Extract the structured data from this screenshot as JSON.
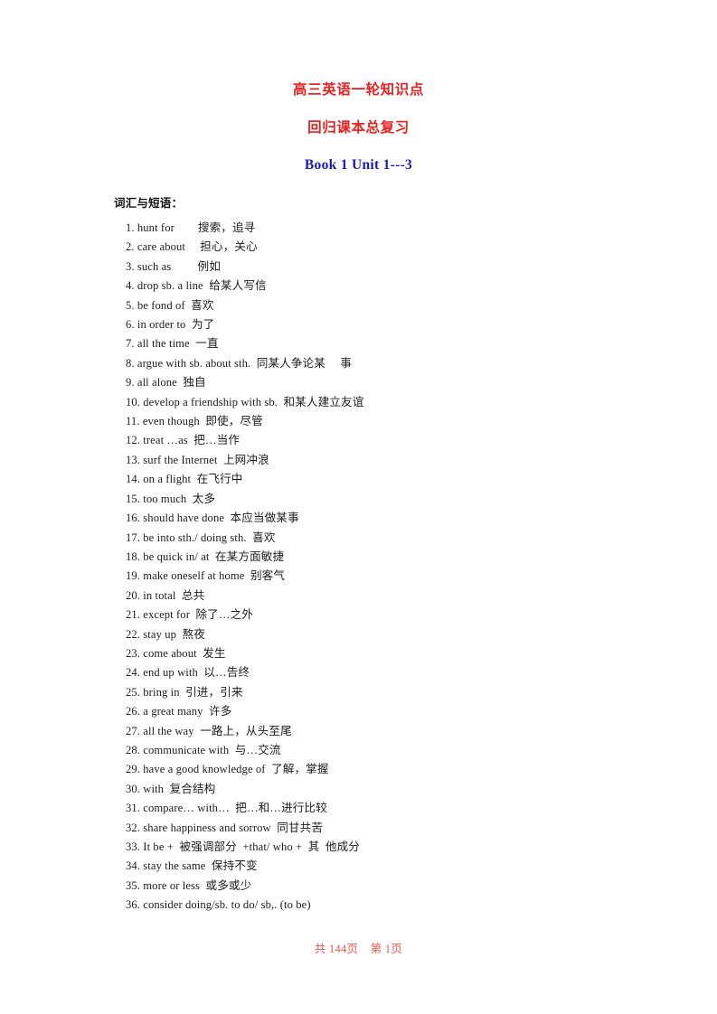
{
  "document": {
    "title": "高三英语一轮知识点",
    "subtitle": "回归课本总复习",
    "unit": "Book 1 Unit  1---3",
    "title_color": "#e8231f",
    "unit_color": "#1a1ab4",
    "footer_color": "#e8564e"
  },
  "section": {
    "heading": "词汇与短语："
  },
  "vocabulary": [
    "1. hunt for        搜索，追寻",
    "2. care about     担心，关心",
    "3. such as         例如",
    "4. drop sb. a line  给某人写信",
    "5. be fond of  喜欢",
    "6. in order to  为了",
    "7. all the time  一直",
    "8. argue with sb. about sth.  同某人争论某     事",
    "9. all alone  独自",
    "10. develop a friendship with sb.  和某人建立友谊",
    "11. even though  即使，尽管",
    "12. treat …as  把…当作",
    "13. surf the Internet  上网冲浪",
    "14. on a flight  在飞行中",
    "15. too much  太多",
    "16. should have done  本应当做某事",
    "17. be into sth./ doing sth.  喜欢",
    "18. be quick in/ at  在某方面敏捷",
    "19. make oneself at home  别客气",
    "20. in total  总共",
    "21. except for  除了…之外",
    "22. stay up  熬夜",
    "23. come about  发生",
    "24. end up with  以…告终",
    "25. bring in  引进，引来",
    "26. a great many  许多",
    "27. all the way  一路上，从头至尾",
    "28. communicate with  与…交流",
    "29. have a good knowledge of  了解，掌握",
    "30. with  复合结构",
    "31. compare… with…  把…和…进行比较",
    "32. share happiness and sorrow  同甘共苦",
    "33. It be +  被强调部分  +that/ who +  其  他成分",
    "34. stay the same  保持不变",
    "35. more or less  或多或少",
    "36. consider doing/sb. to do/ sb,. (to be)"
  ],
  "footer": {
    "text": "共 144页    第 1页"
  }
}
